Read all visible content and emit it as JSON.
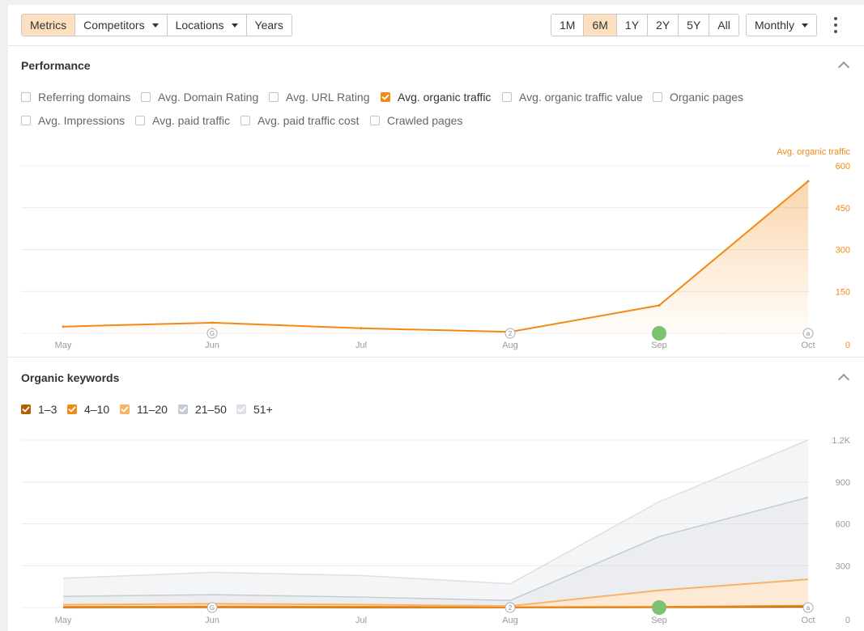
{
  "toolbar": {
    "views": [
      {
        "label": "Metrics",
        "active": true,
        "dropdown": false
      },
      {
        "label": "Competitors",
        "active": false,
        "dropdown": true
      },
      {
        "label": "Locations",
        "active": false,
        "dropdown": true
      },
      {
        "label": "Years",
        "active": false,
        "dropdown": false
      }
    ],
    "ranges": [
      {
        "label": "1M",
        "active": false
      },
      {
        "label": "6M",
        "active": true
      },
      {
        "label": "1Y",
        "active": false
      },
      {
        "label": "2Y",
        "active": false
      },
      {
        "label": "5Y",
        "active": false
      },
      {
        "label": "All",
        "active": false
      }
    ],
    "interval": "Monthly",
    "more_icon": "kebab-menu-icon"
  },
  "performance": {
    "title": "Performance",
    "collapse_icon": "chevron-up-icon",
    "metrics_row1": [
      {
        "label": "Referring domains",
        "checked": false
      },
      {
        "label": "Avg. Domain Rating",
        "checked": false
      },
      {
        "label": "Avg. URL Rating",
        "checked": false
      },
      {
        "label": "Avg. organic traffic",
        "checked": true
      },
      {
        "label": "Avg. organic traffic value",
        "checked": false
      },
      {
        "label": "Organic pages",
        "checked": false
      }
    ],
    "metrics_row2": [
      {
        "label": "Avg. Impressions",
        "checked": false
      },
      {
        "label": "Avg. paid traffic",
        "checked": false
      },
      {
        "label": "Avg. paid traffic cost",
        "checked": false
      },
      {
        "label": "Crawled pages",
        "checked": false
      }
    ]
  },
  "organic_keywords": {
    "title": "Organic keywords",
    "collapse_icon": "chevron-up-icon",
    "ranges": [
      {
        "label": "1–3",
        "color": "#b35f00"
      },
      {
        "label": "4–10",
        "color": "#f18a14"
      },
      {
        "label": "11–20",
        "color": "#f8b366"
      },
      {
        "label": "21–50",
        "color": "#c6ccd4"
      },
      {
        "label": "51+",
        "color": "#dde1e6"
      }
    ]
  },
  "chart_data": [
    {
      "type": "area",
      "series_label": "Avg. organic traffic",
      "color": "#f18a14",
      "categories": [
        "May",
        "Jun",
        "Jul",
        "Aug",
        "Sep",
        "Oct"
      ],
      "series": [
        {
          "name": "Avg. organic traffic",
          "values": [
            24,
            38,
            18,
            5,
            100,
            545
          ]
        }
      ],
      "yticks": [
        "0",
        "150",
        "300",
        "450",
        "600"
      ],
      "ylim": [
        0,
        600
      ],
      "axis_side": "right",
      "grid": true,
      "annotations": [
        {
          "month": "Jun",
          "text": "G",
          "kind": "marker"
        },
        {
          "month": "Aug",
          "text": "2",
          "kind": "marker"
        },
        {
          "month": "Sep",
          "text": "",
          "kind": "dot"
        },
        {
          "month": "Oct",
          "text": "a",
          "kind": "marker"
        }
      ]
    },
    {
      "type": "area",
      "categories": [
        "May",
        "Jun",
        "Jul",
        "Aug",
        "Sep",
        "Oct"
      ],
      "stacked": true,
      "series": [
        {
          "name": "1–3",
          "color": "#b35f00",
          "values": [
            1,
            2,
            1,
            1,
            2,
            5
          ]
        },
        {
          "name": "4–10",
          "color": "#f18a14",
          "values": [
            4,
            5,
            5,
            2,
            3,
            8
          ]
        },
        {
          "name": "11–20",
          "color": "#f8b366",
          "values": [
            15,
            20,
            15,
            8,
            118,
            189
          ]
        },
        {
          "name": "21–50",
          "color": "#c6ccd4",
          "values": [
            60,
            65,
            54,
            40,
            385,
            588
          ]
        },
        {
          "name": "51+",
          "color": "#dde1e6",
          "values": [
            130,
            160,
            155,
            119,
            250,
            410
          ]
        }
      ],
      "yticks": [
        "0",
        "300",
        "600",
        "900",
        "1.2K"
      ],
      "ylim": [
        0,
        1200
      ],
      "axis_side": "right",
      "grid": true,
      "annotations": [
        {
          "month": "Jun",
          "text": "G",
          "kind": "marker"
        },
        {
          "month": "Aug",
          "text": "2",
          "kind": "marker"
        },
        {
          "month": "Sep",
          "text": "",
          "kind": "dot"
        },
        {
          "month": "Oct",
          "text": "a",
          "kind": "marker"
        }
      ]
    }
  ]
}
